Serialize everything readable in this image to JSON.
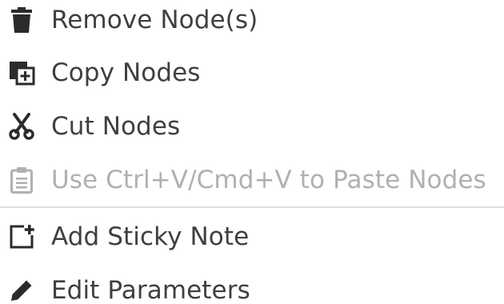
{
  "menu": {
    "items": [
      {
        "label": "Remove Node(s)",
        "icon": "trash-icon",
        "enabled": true
      },
      {
        "label": "Copy Nodes",
        "icon": "copy-icon",
        "enabled": true
      },
      {
        "label": "Cut Nodes",
        "icon": "scissors-icon",
        "enabled": true
      },
      {
        "label": "Use Ctrl+V/Cmd+V to Paste Nodes",
        "icon": "clipboard-icon",
        "enabled": false
      },
      {
        "label": "Add Sticky Note",
        "icon": "sticky-note-icon",
        "enabled": true
      },
      {
        "label": "Edit Parameters",
        "icon": "pencil-icon",
        "enabled": true
      }
    ]
  },
  "colors": {
    "text": "#3f3f3f",
    "icon": "#2b2b2b",
    "disabled": "#b0b0b0",
    "divider": "#e0e0e0",
    "background": "#ffffff"
  }
}
